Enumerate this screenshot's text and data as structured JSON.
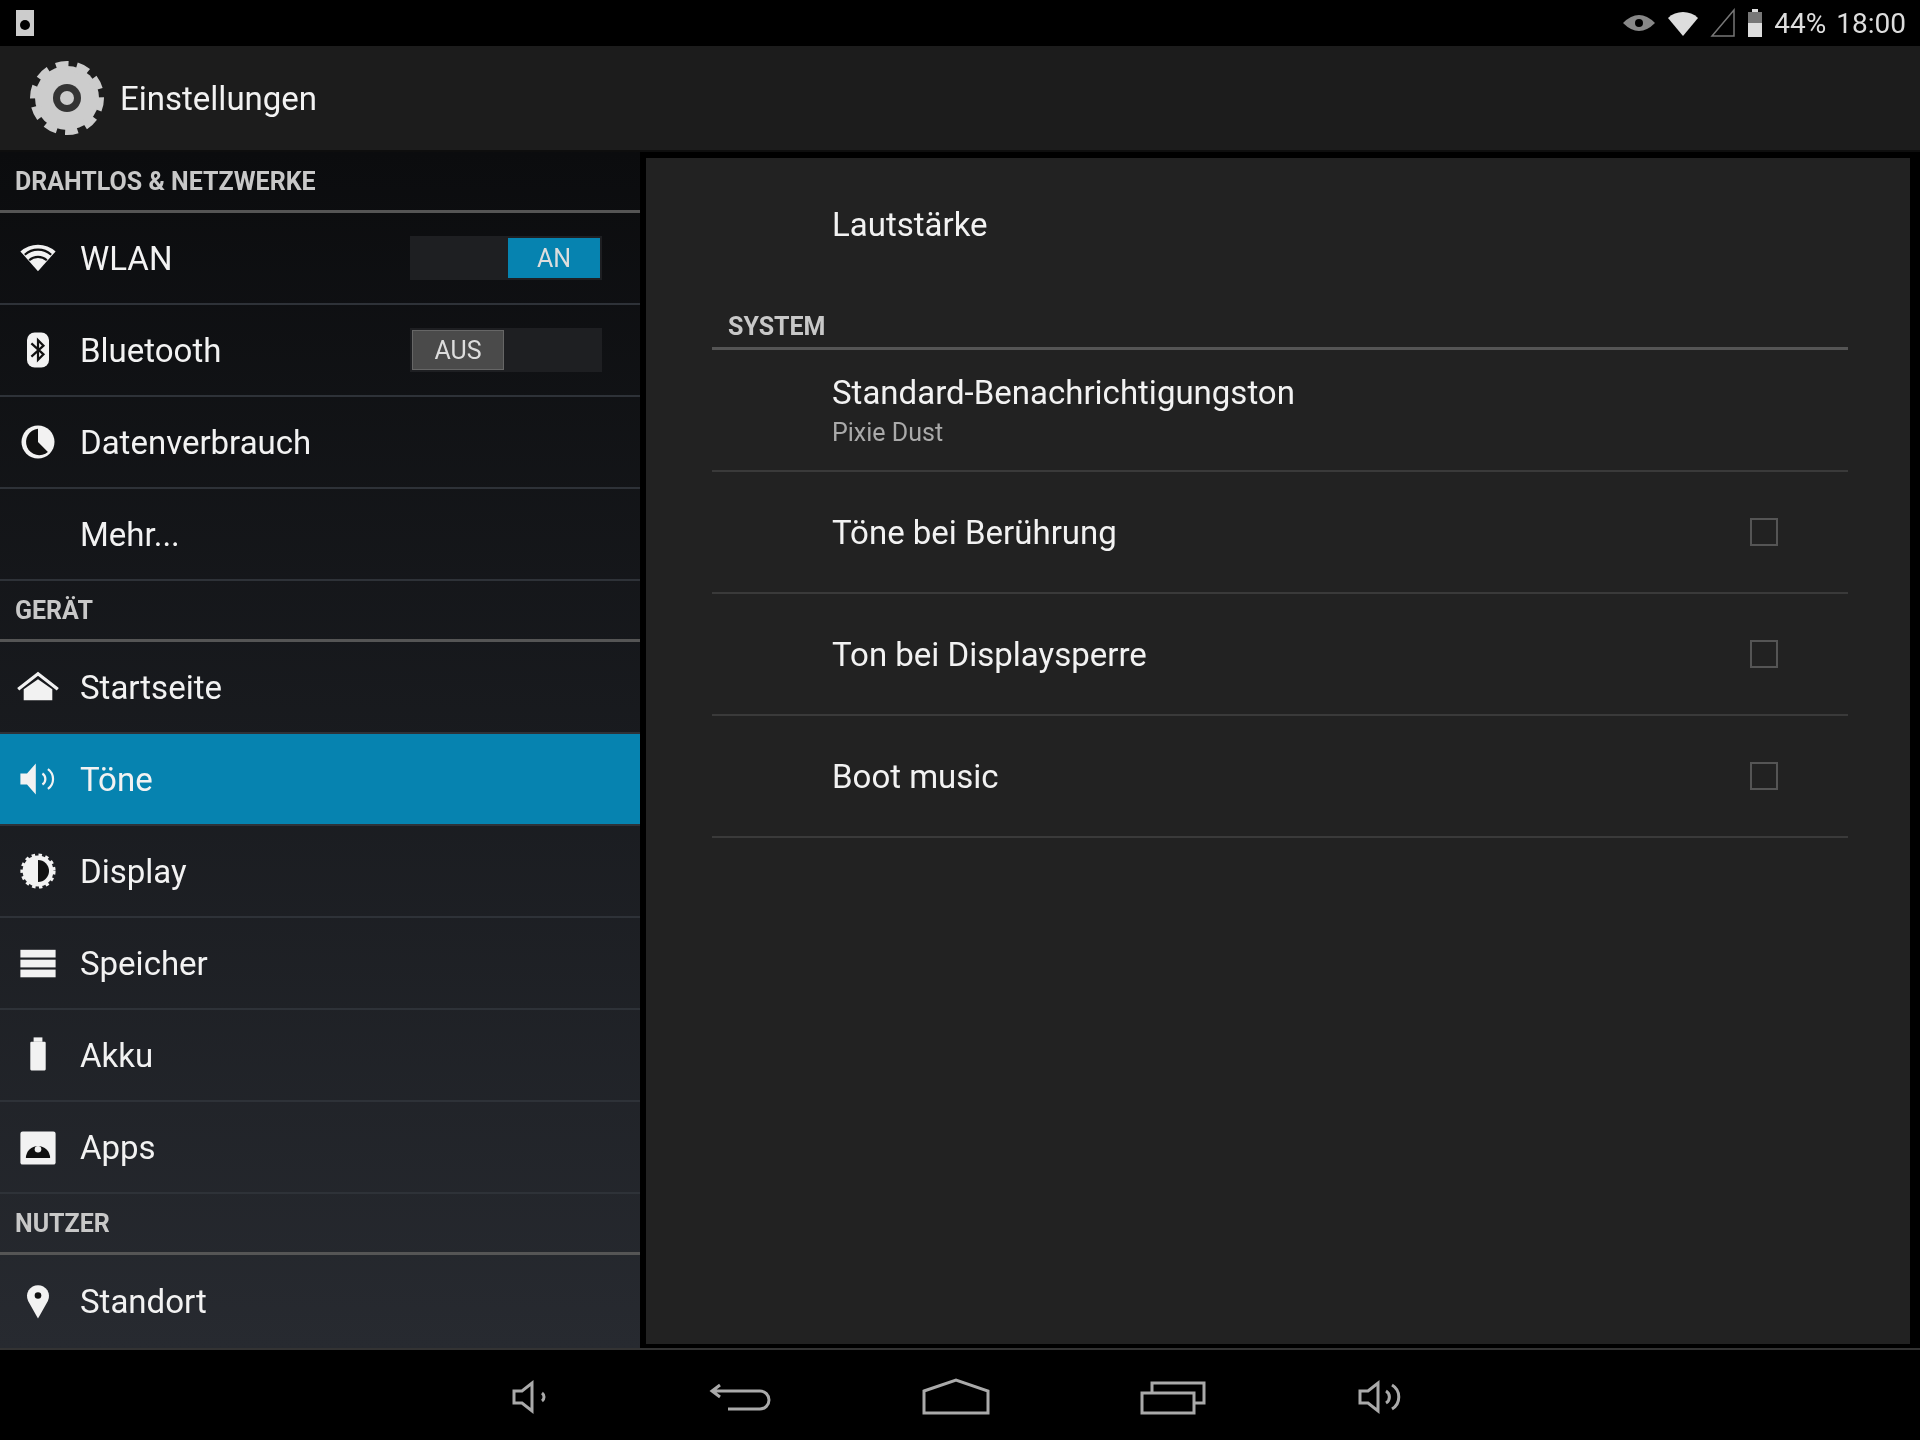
{
  "status_bar": {
    "battery": "44%",
    "time": "18:00"
  },
  "action_bar": {
    "title": "Einstellungen"
  },
  "sidebar": {
    "sections": [
      {
        "header": "DRAHTLOS & NETZWERKE",
        "items": [
          {
            "label": "WLAN",
            "selected": false,
            "switch": {
              "label": "AN",
              "on": true
            }
          },
          {
            "label": "Bluetooth",
            "selected": false,
            "switch": {
              "label": "AUS",
              "on": false
            }
          },
          {
            "label": "Datenverbrauch",
            "selected": false
          },
          {
            "label": "Mehr...",
            "selected": false
          }
        ]
      },
      {
        "header": "GERÄT",
        "items": [
          {
            "label": "Startseite",
            "selected": false
          },
          {
            "label": "Töne",
            "selected": true
          },
          {
            "label": "Display",
            "selected": false
          },
          {
            "label": "Speicher",
            "selected": false
          },
          {
            "label": "Akku",
            "selected": false
          },
          {
            "label": "Apps",
            "selected": false
          }
        ]
      },
      {
        "header": "NUTZER",
        "items": [
          {
            "label": "Standort",
            "selected": false
          }
        ]
      }
    ]
  },
  "detail": {
    "top_item": "Lautstärke",
    "sections": [
      {
        "header": "SYSTEM",
        "items": [
          {
            "kind": "summary",
            "title": "Standard-Benachrichtigungston",
            "summary": "Pixie Dust"
          },
          {
            "kind": "checkbox",
            "title": "Töne bei Berührung",
            "checked": false
          },
          {
            "kind": "checkbox",
            "title": "Ton bei Displaysperre",
            "checked": false
          },
          {
            "kind": "checkbox",
            "title": "Boot music",
            "checked": false
          }
        ]
      }
    ]
  }
}
